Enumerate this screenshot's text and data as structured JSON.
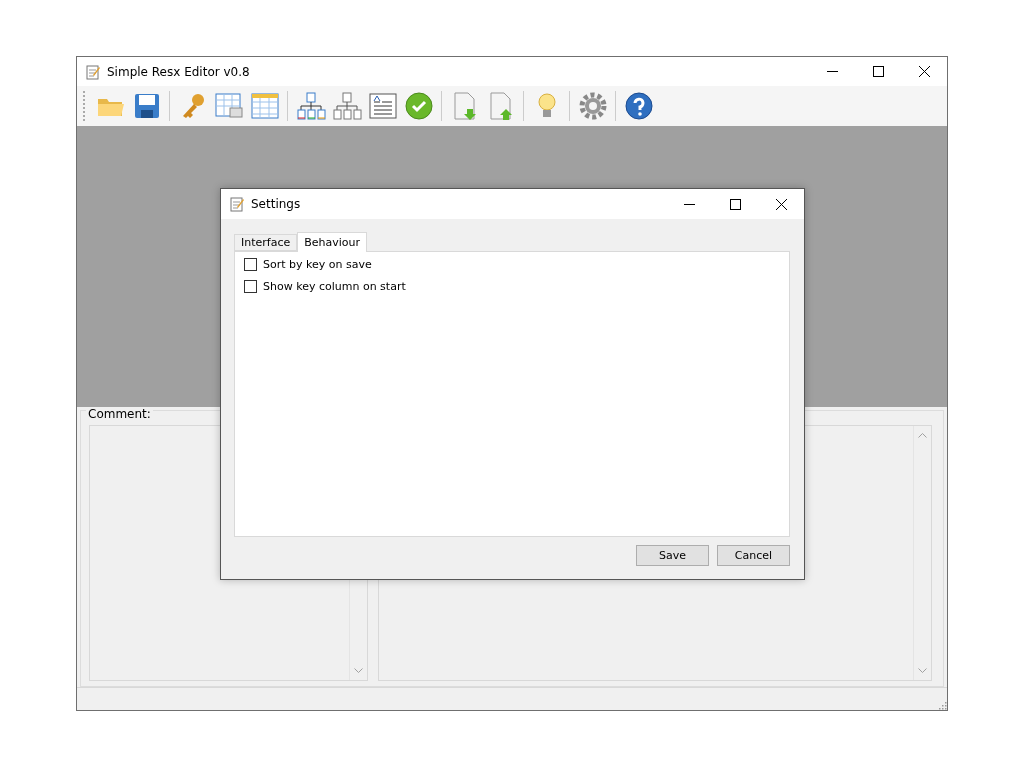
{
  "window": {
    "title": "Simple Resx Editor v0.8"
  },
  "comment_panel": {
    "label": "Comment:"
  },
  "dialog": {
    "title": "Settings",
    "tabs": [
      {
        "label": "Interface",
        "selected": false
      },
      {
        "label": "Behaviour",
        "selected": true
      }
    ],
    "options": [
      {
        "label": "Sort by key on save",
        "checked": false
      },
      {
        "label": "Show key column on start",
        "checked": false
      }
    ],
    "buttons": [
      "Save",
      "Cancel"
    ]
  }
}
